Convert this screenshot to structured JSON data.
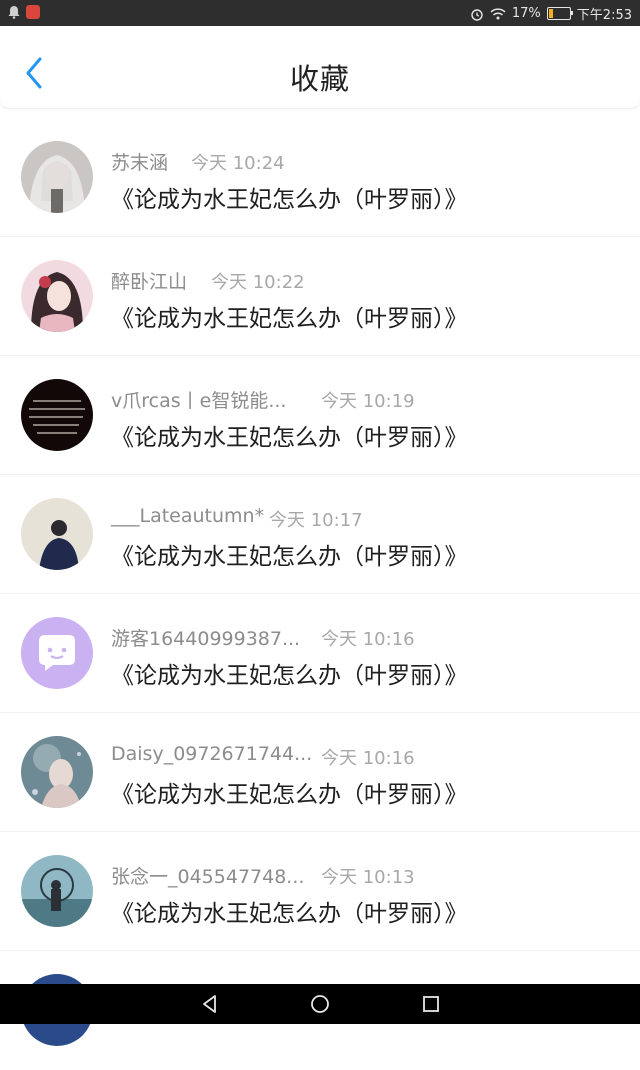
{
  "status_bar": {
    "battery_percent": "17%",
    "time": "下午2:53"
  },
  "header": {
    "title": "收藏",
    "back_icon": "chevron-left-icon",
    "accent_color": "#2196F3"
  },
  "items": [
    {
      "name": "苏末涵",
      "time": "今天 10:24",
      "text": "《论成为水王妃怎么办（叶罗丽）》"
    },
    {
      "name": "醉卧江山",
      "time": "今天 10:22",
      "text": "《论成为水王妃怎么办（叶罗丽）》"
    },
    {
      "name": "v爪rcas丨e智锐能...",
      "time": "今天 10:19",
      "text": "《论成为水王妃怎么办（叶罗丽）》"
    },
    {
      "name": "___Lateautumn*",
      "time": "今天 10:17",
      "text": "《论成为水王妃怎么办（叶罗丽）》"
    },
    {
      "name": "游客16440999387...",
      "time": "今天 10:16",
      "text": "《论成为水王妃怎么办（叶罗丽）》"
    },
    {
      "name": "Daisy_0972671744...",
      "time": "今天 10:16",
      "text": "《论成为水王妃怎么办（叶罗丽）》"
    },
    {
      "name": "张念一_045547748...",
      "time": "今天 10:13",
      "text": "《论成为水王妃怎么办（叶罗丽）》"
    }
  ]
}
